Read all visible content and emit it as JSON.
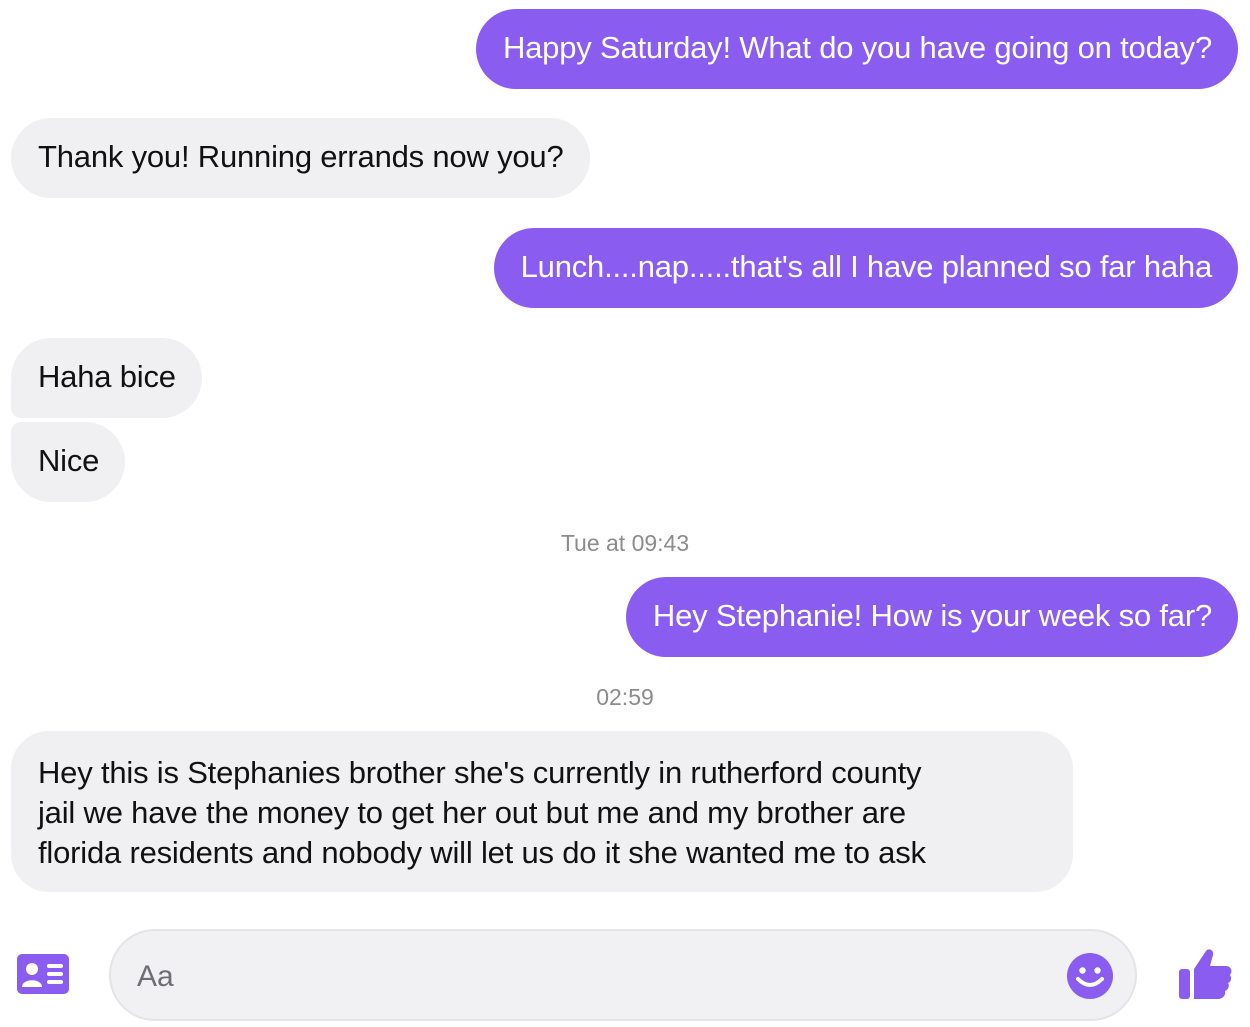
{
  "thread": {
    "messages": [
      {
        "direction": "outgoing",
        "text": "Happy Saturday!  What do you have going on today?"
      },
      {
        "direction": "incoming",
        "text": "Thank you! Running errands now you?"
      },
      {
        "direction": "outgoing",
        "text": "Lunch....nap.....that's all I have planned so far haha"
      },
      {
        "direction": "incoming",
        "text": "Haha bice"
      },
      {
        "direction": "incoming",
        "text": "Nice"
      },
      {
        "direction": "outgoing",
        "text": "Hey Stephanie! How is your week so far?"
      },
      {
        "direction": "incoming",
        "lines": [
          "Hey this is Stephanies brother she's currently in rutherford county",
          "jail we have the money to get her out but me and my brother are",
          "florida residents and nobody will let us do it she wanted me to ask"
        ]
      }
    ],
    "timestamps": [
      "Tue at 09:43",
      "02:59"
    ]
  },
  "composer": {
    "placeholder": "Aa",
    "value": ""
  },
  "icons": {
    "contact_card": "contact-card-icon",
    "emoji": "smiley-emoji-icon",
    "like": "thumbs-up-icon"
  },
  "colors": {
    "outgoing_bubble": "#8a5cf0",
    "incoming_bubble": "#f0f0f3",
    "accent": "#8a5cf0"
  }
}
